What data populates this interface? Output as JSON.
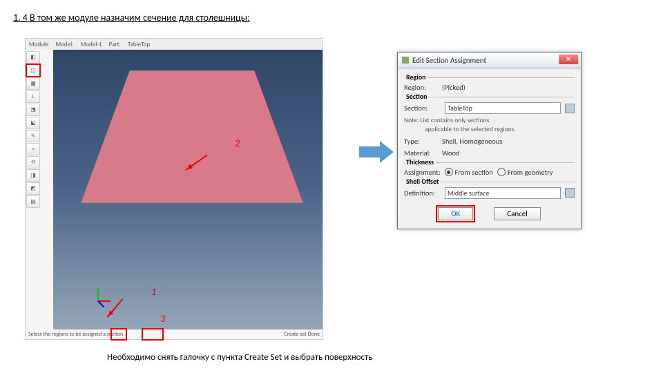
{
  "page": {
    "title": "1. 4 В том же модуле назначим сечение для столешницы:",
    "footer": "Необходимо снять галочку с пункта Create Set и выбрать поверхность"
  },
  "menu": {
    "module": "Module",
    "model": "Model:",
    "modelv": "Model-1",
    "part": "Part:",
    "partv": "TableTop"
  },
  "annot": {
    "a1": "1",
    "a2": "2",
    "a3": "3"
  },
  "status": {
    "text": "Select the regions to be assigned a section",
    "opts": "Create set  Done"
  },
  "dlg": {
    "title": "Edit Section Assignment",
    "region_grp": "Region",
    "region_lbl": "Region:",
    "region_val": "(Picked)",
    "section_grp": "Section",
    "section_lbl": "Section:",
    "section_val": "TableTop",
    "note1": "Note:  List contains only sections",
    "note2": "applicable to the selected regions.",
    "type_lbl": "Type:",
    "type_val": "Shell, Homogeneous",
    "mat_lbl": "Material:",
    "mat_val": "Wood",
    "thick_grp": "Thickness",
    "assign_lbl": "Assignment:",
    "from_sec": "From section",
    "from_geo": "From geometry",
    "offset_grp": "Shell Offset",
    "def_lbl": "Definition:",
    "def_val": "Middle surface",
    "ok": "OK",
    "cancel": "Cancel"
  }
}
